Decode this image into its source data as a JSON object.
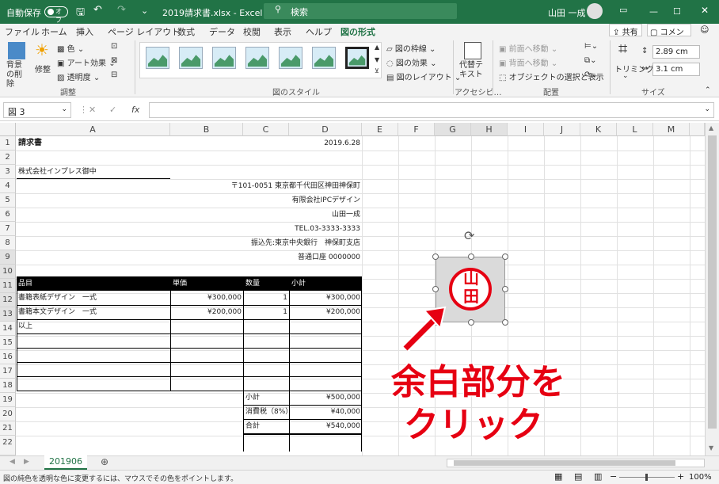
{
  "titlebar": {
    "autosave": "自動保存",
    "toggle": "オフ",
    "filename": "2019請求書.xlsx - Excel",
    "search": "検索",
    "user": "山田 一成"
  },
  "menu": [
    "ファイル",
    "ホーム",
    "挿入",
    "ページ レイアウト",
    "数式",
    "データ",
    "校閲",
    "表示",
    "ヘルプ",
    "図の形式"
  ],
  "menu_right": {
    "share": "共有",
    "comment": "コメント"
  },
  "ribbon": {
    "remove_bg": "背景の削除",
    "correct": "修整",
    "color": "色",
    "art": "アート効果",
    "transparency": "透明度",
    "group_adjust": "調整",
    "group_styles": "図のスタイル",
    "border": "図の枠線",
    "effects": "図の効果",
    "layout": "図のレイアウト",
    "alt_text": "代替テキスト",
    "group_access": "アクセシビ…",
    "forward": "前面へ移動",
    "backward": "背面へ移動",
    "selection": "オブジェクトの選択と表示",
    "group_arrange": "配置",
    "crop": "トリミング",
    "height": "2.89 cm",
    "width": "3.1 cm",
    "group_size": "サイズ"
  },
  "formula": {
    "name": "図 3",
    "fx": "fx"
  },
  "columns": [
    "A",
    "B",
    "C",
    "D",
    "E",
    "F",
    "G",
    "H",
    "I",
    "J",
    "K",
    "L",
    "M"
  ],
  "rows": [
    "1",
    "2",
    "3",
    "4",
    "5",
    "6",
    "7",
    "8",
    "9",
    "10",
    "11",
    "12",
    "13",
    "14",
    "15",
    "16",
    "17",
    "18",
    "19",
    "20",
    "21",
    "22"
  ],
  "sheet": {
    "title": "請求書",
    "date": "2019.6.28",
    "client": "株式会社インプレス御中",
    "addr1": "〒101-0051 東京都千代田区神田神保町",
    "addr2": "有限会社IPCデザイン",
    "addr3": "山田一成",
    "addr4": "TEL.03-3333-3333",
    "addr5": "振込先:東京中央銀行　神保町支店",
    "addr6": "普通口座 0000000",
    "h_item": "品目",
    "h_price": "単価",
    "h_qty": "数量",
    "h_sub": "小計",
    "r1_item": "書籍表紙デザイン　一式",
    "r1_price": "¥300,000",
    "r1_qty": "1",
    "r1_sub": "¥300,000",
    "r2_item": "書籍本文デザイン　一式",
    "r2_price": "¥200,000",
    "r2_qty": "1",
    "r2_sub": "¥200,000",
    "r3_item": "以上",
    "sub_label": "小計",
    "sub_val": "¥500,000",
    "tax_label": "消費税（8%）",
    "tax_val": "¥40,000",
    "total_label": "合計",
    "total_val": "¥540,000"
  },
  "stamp": "山田",
  "callout": {
    "line1": "余白部分を",
    "line2": "クリック"
  },
  "sheet_tab": "201906",
  "status": {
    "message": "図の純色を透明な色に変更するには、マウスでその色をポイントします。",
    "zoom": "100%"
  }
}
